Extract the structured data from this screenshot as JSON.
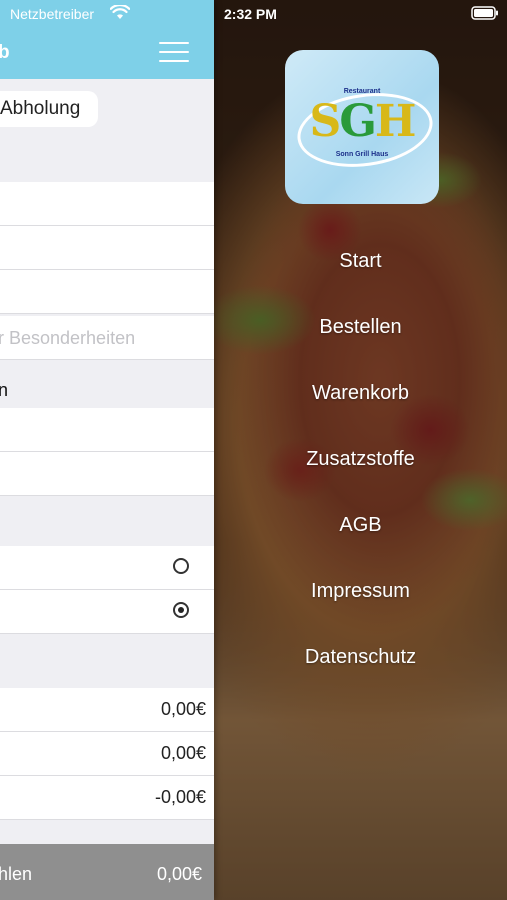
{
  "statusbar": {
    "carrier": "Netzbetreiber",
    "time": "2:32 PM"
  },
  "drawer": {
    "logo": {
      "small_text": "Restaurant",
      "main_text_1": "S",
      "main_text_2": "G",
      "main_text_3": "H",
      "sub_text": "Sonn Grill Haus"
    },
    "menu_items": [
      {
        "label": "Start"
      },
      {
        "label": "Bestellen"
      },
      {
        "label": "Warenkorb"
      },
      {
        "label": "Zusatzstoffe"
      },
      {
        "label": "AGB"
      },
      {
        "label": "Impressum"
      },
      {
        "label": "Datenschutz"
      }
    ]
  },
  "basket": {
    "title": "b",
    "pickup_chip": "Abholung",
    "notes_placeholder": "r Besonderheiten",
    "section_label": "n",
    "summary_values": [
      "0,00€",
      "0,00€",
      "-0,00€"
    ],
    "footer_label": "hlen",
    "footer_total": "0,00€"
  },
  "colors": {
    "navbar": "#7ed0e8",
    "footer": "#8f8f8f",
    "panel_bg": "#efeff3"
  }
}
